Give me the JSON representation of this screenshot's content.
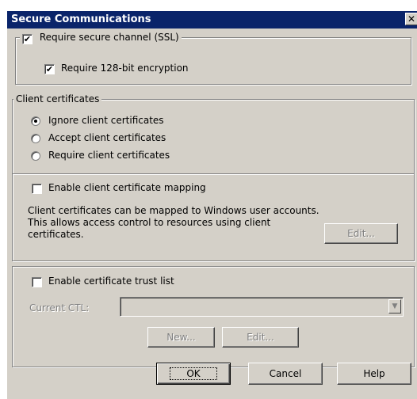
{
  "window": {
    "title": "Secure Communications",
    "close_glyph": "✕"
  },
  "ssl": {
    "require_secure_channel": "Require secure channel (SSL)",
    "require_secure_channel_checked": true,
    "require_128bit": "Require 128-bit encryption",
    "require_128bit_checked": true
  },
  "client_certificates": {
    "legend": "Client certificates",
    "options": [
      {
        "label": "Ignore client certificates",
        "selected": true
      },
      {
        "label": "Accept client certificates",
        "selected": false
      },
      {
        "label": "Require client certificates",
        "selected": false
      }
    ],
    "mapping": {
      "label": "Enable client certificate mapping",
      "checked": false,
      "description": "Client certificates can be mapped to Windows user accounts.  This allows access control to resources using client certificates.",
      "edit_button": "Edit..."
    }
  },
  "trust_list": {
    "label": "Enable certificate trust list",
    "checked": false,
    "current_ctl_label": "Current CTL:",
    "current_ctl_value": "",
    "new_button": "New...",
    "edit_button": "Edit..."
  },
  "footer": {
    "ok": "OK",
    "cancel": "Cancel",
    "help": "Help"
  },
  "icons": {
    "checkmark": "check-icon",
    "dropdown": "chevron-down-icon",
    "close": "close-icon"
  }
}
